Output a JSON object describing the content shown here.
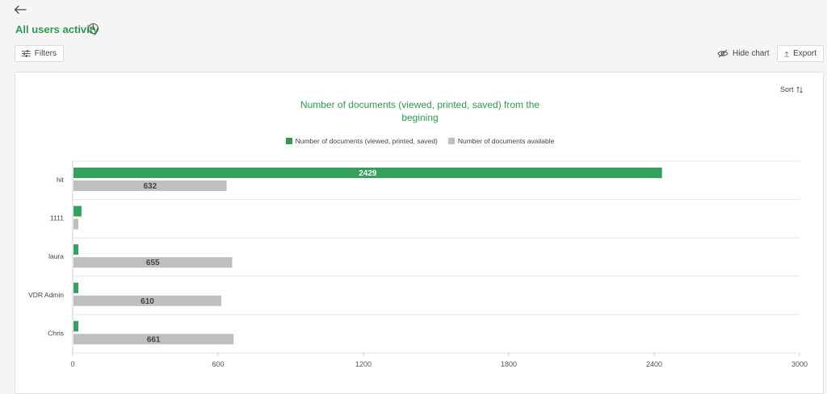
{
  "header": {
    "title": "All users activity"
  },
  "toolbar": {
    "filters_label": "Filters",
    "hide_chart_label": "Hide chart",
    "export_label": "Export",
    "sort_label": "Sort"
  },
  "colors": {
    "accent": "#2e9a52",
    "viewed_bar": "#35a05e",
    "available_bar": "#bfbfbf"
  },
  "chart_data": {
    "type": "bar",
    "orientation": "horizontal",
    "title": "Number of documents (viewed, printed, saved) from the begining",
    "categories": [
      "hit",
      "1111",
      "laura",
      "VDR Admin",
      "Chris"
    ],
    "series": [
      {
        "name": "Number of documents (viewed, printed, saved)",
        "values": [
          2429,
          33,
          20,
          20,
          20
        ],
        "color": "#35a05e"
      },
      {
        "name": "Number of documents available",
        "values": [
          632,
          20,
          655,
          610,
          661
        ],
        "color": "#bfbfbf"
      }
    ],
    "data_labels": [
      [
        "2429",
        "",
        "",
        "",
        ""
      ],
      [
        "632",
        "",
        "655",
        "610",
        "661"
      ]
    ],
    "xlim": [
      0,
      3000
    ],
    "xticks": [
      0,
      600,
      1200,
      1800,
      2400,
      3000
    ],
    "legend_position": "top-center",
    "grid": true
  }
}
